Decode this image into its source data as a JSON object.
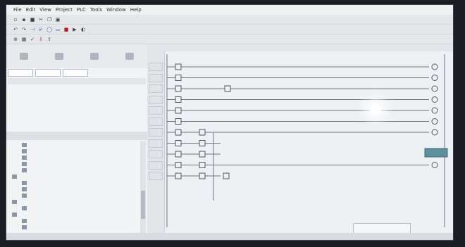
{
  "menu": [
    {
      "label": "File"
    },
    {
      "label": "Edit"
    },
    {
      "label": "View"
    },
    {
      "label": "Project"
    },
    {
      "label": "PLC"
    },
    {
      "label": "Tools"
    },
    {
      "label": "Window"
    },
    {
      "label": "Help"
    }
  ],
  "toolbar_icons": [
    {
      "icon": "new-icon",
      "glyph": "▫",
      "tone": "",
      "row": 1
    },
    {
      "icon": "open-icon",
      "glyph": "▪",
      "tone": "",
      "row": 1
    },
    {
      "icon": "save-icon",
      "glyph": "■",
      "tone": "",
      "row": 1
    },
    {
      "icon": "cut-icon",
      "glyph": "✂",
      "tone": "",
      "row": 1
    },
    {
      "icon": "copy-icon",
      "glyph": "❐",
      "tone": "",
      "row": 1
    },
    {
      "icon": "paste-icon",
      "glyph": "▣",
      "tone": "",
      "row": 1
    },
    {
      "icon": "undo-icon",
      "glyph": "↶",
      "tone": "",
      "row": 2
    },
    {
      "icon": "redo-icon",
      "glyph": "↷",
      "tone": "",
      "row": 2
    },
    {
      "icon": "contact-no-icon",
      "glyph": "⊣",
      "tone": "blue",
      "row": 2
    },
    {
      "icon": "contact-nc-icon",
      "glyph": "⊬",
      "tone": "blue",
      "row": 2
    },
    {
      "icon": "coil-icon",
      "glyph": "◯",
      "tone": "blue",
      "row": 2
    },
    {
      "icon": "function-block-icon",
      "glyph": "▭",
      "tone": "blue",
      "row": 2
    },
    {
      "icon": "stop-icon",
      "glyph": "■",
      "tone": "red",
      "row": 2
    },
    {
      "icon": "run-icon",
      "glyph": "▶",
      "tone": "",
      "row": 2
    },
    {
      "icon": "monitor-icon",
      "glyph": "◐",
      "tone": "",
      "row": 2
    },
    {
      "icon": "zoom-icon",
      "glyph": "⊕",
      "tone": "",
      "row": 3
    },
    {
      "icon": "grid-icon",
      "glyph": "▦",
      "tone": "",
      "row": 3
    },
    {
      "icon": "compile-icon",
      "glyph": "✓",
      "tone": "",
      "row": 3
    },
    {
      "icon": "download-icon",
      "glyph": "⇩",
      "tone": "red",
      "row": 3
    },
    {
      "icon": "upload-icon",
      "glyph": "⇧",
      "tone": "",
      "row": 3
    }
  ],
  "panel_buttons": [
    {
      "icon": "project-icon"
    },
    {
      "icon": "device-icon"
    },
    {
      "icon": "library-icon"
    },
    {
      "icon": "wizard-icon"
    }
  ],
  "filter": {
    "field1": "",
    "field2": "",
    "field3": ""
  },
  "list_columns": [
    "",
    "",
    ""
  ],
  "list_rows": [
    {
      "num": "",
      "name": "",
      "selected": true
    },
    {
      "num": "",
      "name": "",
      "selected": false
    },
    {
      "num": "",
      "name": "",
      "selected": false
    },
    {
      "num": "",
      "name": "",
      "selected": false
    },
    {
      "num": "",
      "name": "",
      "selected": false
    },
    {
      "num": "",
      "name": "",
      "selected": false
    }
  ],
  "status_line": {
    "left": "",
    "right": ""
  },
  "tree_items": [
    {
      "label": "",
      "indent": 1
    },
    {
      "label": "",
      "indent": 1
    },
    {
      "label": "",
      "indent": 1
    },
    {
      "label": "",
      "indent": 1
    },
    {
      "label": "",
      "indent": 1
    },
    {
      "label": "",
      "indent": 0
    },
    {
      "label": "",
      "indent": 1
    },
    {
      "label": "",
      "indent": 1
    },
    {
      "label": "",
      "indent": 1
    },
    {
      "label": "",
      "indent": 0
    },
    {
      "label": "",
      "indent": 1
    },
    {
      "label": "",
      "indent": 0
    },
    {
      "label": "",
      "indent": 1
    },
    {
      "label": "",
      "indent": 1
    }
  ],
  "rungs": [
    {
      "num": "",
      "contacts": 1,
      "has_coil": true,
      "mid_contact": false
    },
    {
      "num": "",
      "contacts": 1,
      "has_coil": true,
      "mid_contact": false
    },
    {
      "num": "",
      "contacts": 1,
      "has_coil": true,
      "mid_contact": true
    },
    {
      "num": "",
      "contacts": 1,
      "has_coil": true,
      "mid_contact": false
    },
    {
      "num": "",
      "contacts": 1,
      "has_coil": true,
      "mid_contact": false
    },
    {
      "num": "",
      "contacts": 1,
      "has_coil": true,
      "mid_contact": false
    },
    {
      "num": "",
      "contacts": 2,
      "has_coil": true,
      "mid_contact": false
    },
    {
      "num": "",
      "contacts": 2,
      "has_coil": false,
      "mid_contact": false
    },
    {
      "num": "",
      "contacts": 2,
      "has_coil": false,
      "mid_contact": false
    },
    {
      "num": "",
      "contacts": 2,
      "has_coil": true,
      "mid_contact": false
    },
    {
      "num": "",
      "contacts": 3,
      "has_coil": false,
      "mid_contact": false
    }
  ],
  "bottom_status": {
    "left": "",
    "mid": ""
  },
  "property_box": {
    "label": ""
  },
  "colors": {
    "selected_row": "#2a67c9",
    "teal_block": "#5d8f9c",
    "rung_line": "#6b7480"
  }
}
